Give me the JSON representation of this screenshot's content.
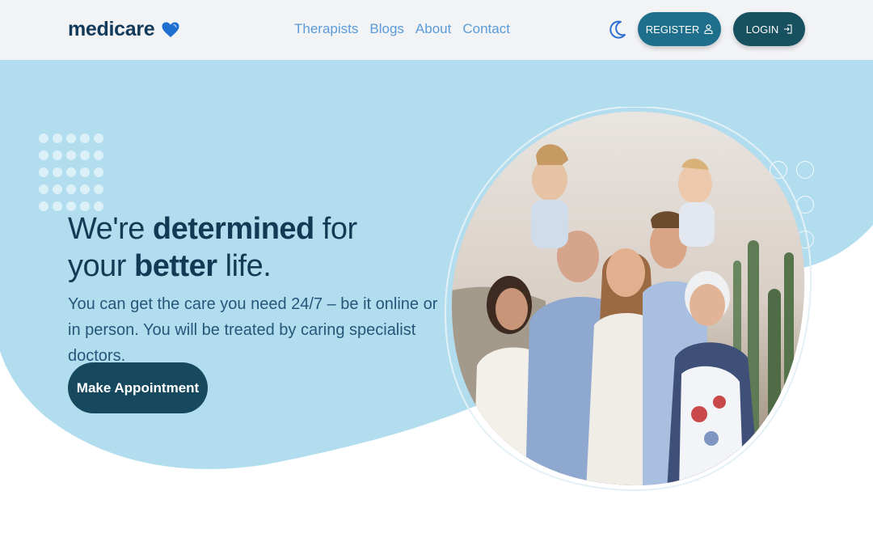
{
  "brand": {
    "name": "medicare",
    "icon": "heart-icon"
  },
  "nav": {
    "links": [
      "Therapists",
      "Blogs",
      "About",
      "Contact"
    ],
    "theme_icon": "moon-icon",
    "register_label": "REGISTER",
    "login_label": "LOGIN"
  },
  "hero": {
    "headline": {
      "line1_pre": "We're ",
      "line1_bold": "determined",
      "line1_post": " for",
      "line2_pre": "your ",
      "line2_bold": "better",
      "line2_post": " life."
    },
    "subtext": "You can get the care you need 24/7 – be it online or in person. You will be treated by caring specialist doctors.",
    "cta_label": "Make Appointment"
  },
  "colors": {
    "hero_bg": "#b2ddee",
    "primary": "#1d6f8c",
    "dark": "#17495e",
    "nav_link": "#5b9bd9",
    "heading": "#133a55"
  }
}
